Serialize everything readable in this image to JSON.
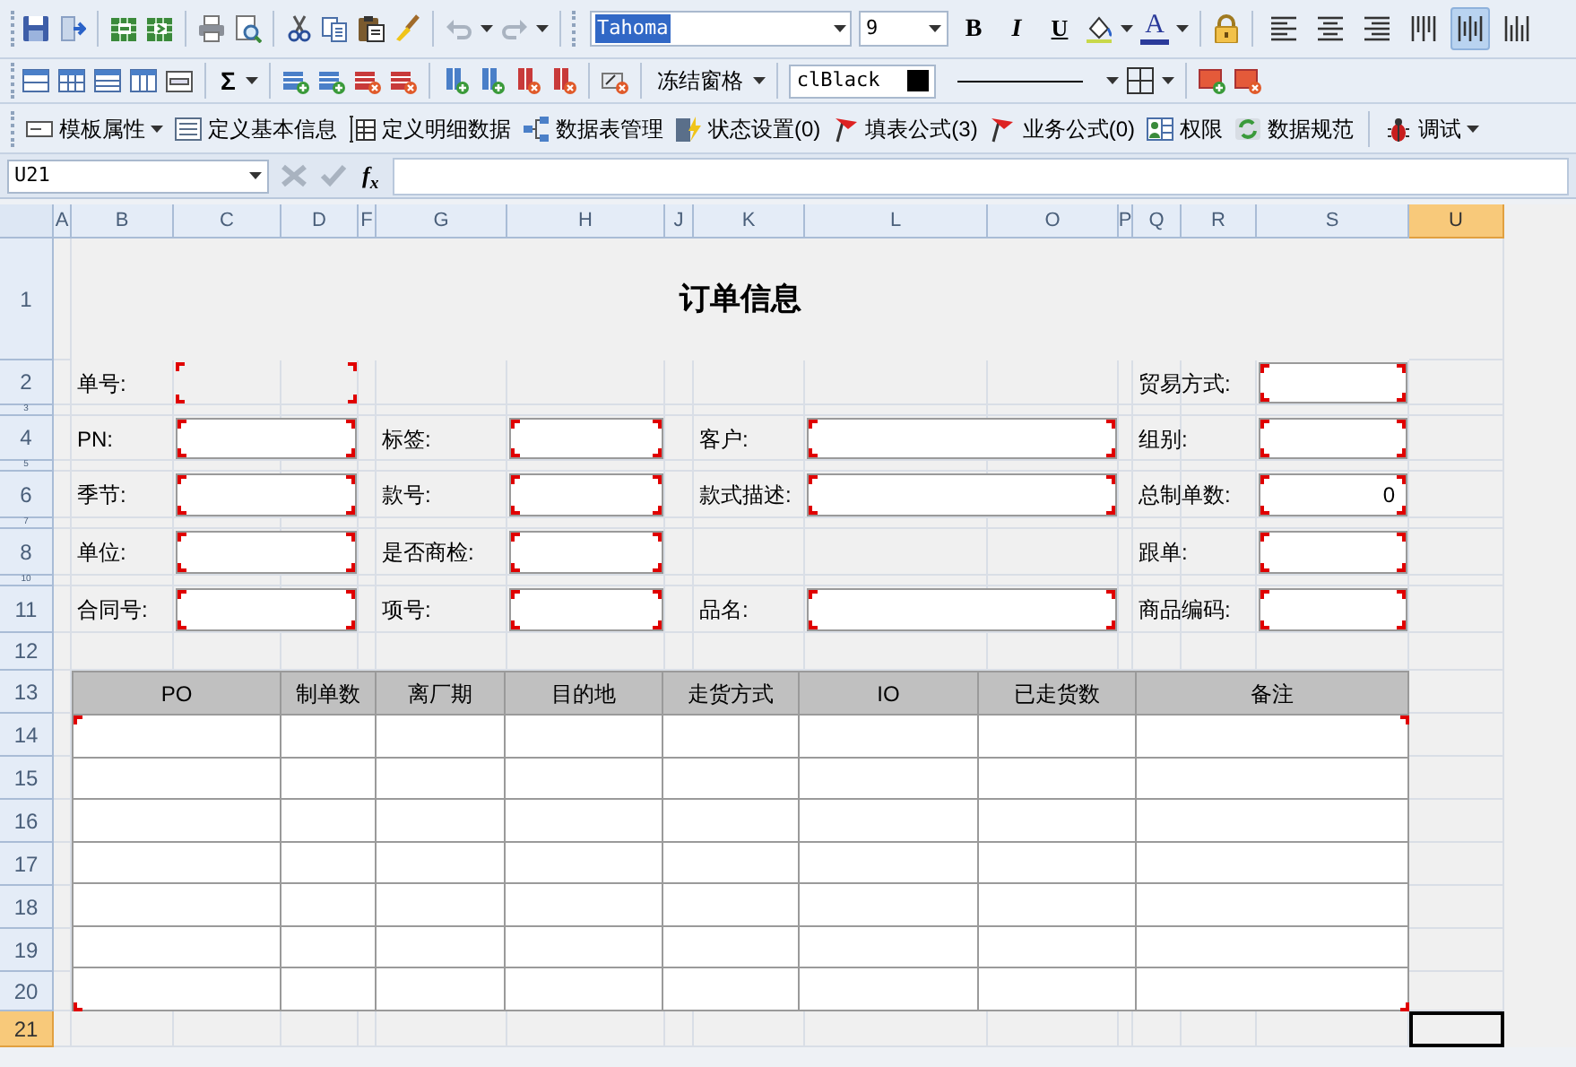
{
  "standard_toolbar": {
    "font_name": "Tahoma",
    "font_name_highlighted": true,
    "font_size": "9",
    "bold": "B",
    "italic": "I",
    "underline": "U",
    "font_color": "A",
    "alignment": [
      {
        "selected": false
      },
      {
        "selected": false
      },
      {
        "selected": false
      },
      {
        "selected": false
      },
      {
        "selected": true
      },
      {
        "selected": false
      }
    ]
  },
  "format_toolbar": {
    "sum": "Σ",
    "freeze_panes": "冻结窗格",
    "color_label": "clBlack"
  },
  "design_toolbar": [
    {
      "label": "模板属性",
      "dropdown": true
    },
    {
      "label": "定义基本信息",
      "dropdown": false
    },
    {
      "label": "定义明细数据",
      "dropdown": false
    },
    {
      "label": "数据表管理",
      "dropdown": false
    },
    {
      "label": "状态设置(0)",
      "dropdown": false
    },
    {
      "label": "填表公式(3)",
      "dropdown": false
    },
    {
      "label": "业务公式(0)",
      "dropdown": false
    },
    {
      "label": "权限",
      "dropdown": false
    },
    {
      "label": "数据规范",
      "dropdown": false
    },
    {
      "label": "调试",
      "dropdown": true
    }
  ],
  "formula_bar": {
    "cell_ref": "U21",
    "function_label": "f$_{x}$"
  },
  "sheet": {
    "columns": [
      {
        "label": "A",
        "selected": false
      },
      {
        "label": "B",
        "selected": false
      },
      {
        "label": "C",
        "selected": false
      },
      {
        "label": "D",
        "selected": false
      },
      {
        "label": "F",
        "selected": false
      },
      {
        "label": "G",
        "selected": false
      },
      {
        "label": "H",
        "selected": false
      },
      {
        "label": "J",
        "selected": false
      },
      {
        "label": "K",
        "selected": false
      },
      {
        "label": "L",
        "selected": false
      },
      {
        "label": "O",
        "selected": false
      },
      {
        "label": "P",
        "selected": false
      },
      {
        "label": "Q",
        "selected": false
      },
      {
        "label": "R",
        "selected": false
      },
      {
        "label": "S",
        "selected": false
      },
      {
        "label": "U",
        "selected": true
      }
    ],
    "rows": [
      {
        "label": "1",
        "selected": false
      },
      {
        "label": "2",
        "selected": false
      },
      {
        "label": "3",
        "selected": false
      },
      {
        "label": "4",
        "selected": false
      },
      {
        "label": "5",
        "selected": false
      },
      {
        "label": "6",
        "selected": false
      },
      {
        "label": "7",
        "selected": false
      },
      {
        "label": "8",
        "selected": false
      },
      {
        "label": "10",
        "selected": false
      },
      {
        "label": "11",
        "selected": false
      },
      {
        "label": "12",
        "selected": false
      },
      {
        "label": "13",
        "selected": false
      },
      {
        "label": "14",
        "selected": false
      },
      {
        "label": "15",
        "selected": false
      },
      {
        "label": "16",
        "selected": false
      },
      {
        "label": "17",
        "selected": false
      },
      {
        "label": "18",
        "selected": false
      },
      {
        "label": "19",
        "selected": false
      },
      {
        "label": "20",
        "selected": false
      },
      {
        "label": "21",
        "selected": true
      }
    ],
    "title": "订单信息",
    "form_rows": [
      [
        {
          "label": "单号:",
          "kind": "plain"
        },
        {
          "label": "贸易方式:",
          "kind": "box"
        }
      ],
      [
        {
          "label": "PN:",
          "kind": "box"
        },
        {
          "label": "标签:",
          "kind": "box"
        },
        {
          "label": "客户:",
          "kind": "box"
        },
        {
          "label": "组别:",
          "kind": "box"
        }
      ],
      [
        {
          "label": "季节:",
          "kind": "box"
        },
        {
          "label": "款号:",
          "kind": "box"
        },
        {
          "label": "款式描述:",
          "kind": "box"
        },
        {
          "label": "总制单数:",
          "kind": "box",
          "value": "0"
        }
      ],
      [
        {
          "label": "单位:",
          "kind": "box"
        },
        {
          "label": "是否商检:",
          "kind": "box"
        },
        {
          "label": "跟单:",
          "kind": "box"
        }
      ],
      [
        {
          "label": "合同号:",
          "kind": "box"
        },
        {
          "label": "项号:",
          "kind": "box"
        },
        {
          "label": "品名:",
          "kind": "box"
        },
        {
          "label": "商品编码:",
          "kind": "box"
        }
      ]
    ],
    "detail_table": {
      "columns": [
        "PO",
        "制单数",
        "离厂期",
        "目的地",
        "走货方式",
        "IO",
        "已走货数",
        "备注"
      ]
    }
  }
}
